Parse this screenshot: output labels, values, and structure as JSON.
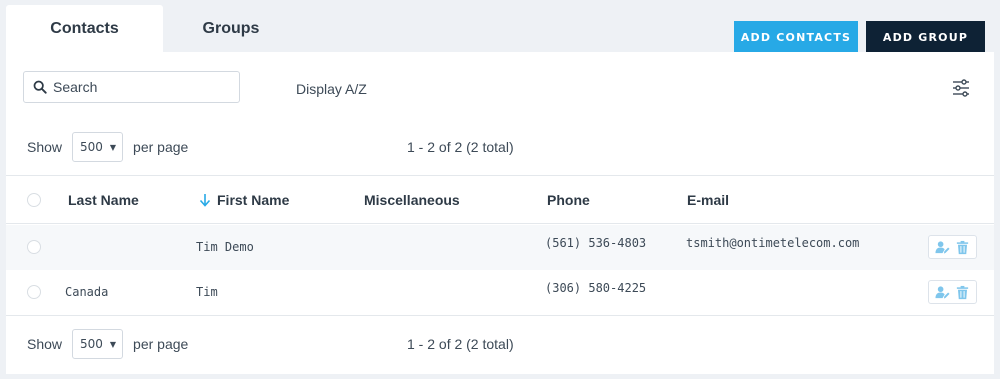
{
  "tabs": [
    {
      "label": "Contacts",
      "active": true
    },
    {
      "label": "Groups",
      "active": false
    }
  ],
  "buttons": {
    "add_contacts": "ADD CONTACTS",
    "add_group": "ADD GROUP"
  },
  "search": {
    "placeholder": "Search",
    "value": ""
  },
  "display_label": "Display A/Z",
  "pager_top": {
    "show": "Show",
    "per_page_value": "500",
    "per_page": "per page",
    "range": "1 - 2 of 2 (2 total)"
  },
  "pager_bottom": {
    "show": "Show",
    "per_page_value": "500",
    "per_page": "per page",
    "range": "1 - 2 of 2 (2 total)"
  },
  "columns": {
    "last_name": "Last Name",
    "first_name": "First Name",
    "misc": "Miscellaneous",
    "phone": "Phone",
    "email": "E-mail"
  },
  "sort": {
    "column": "first_name",
    "direction": "descending",
    "icon": "arrow-down-icon"
  },
  "rows": [
    {
      "last_name": "",
      "first_name": "Tim Demo",
      "misc": "",
      "phone": "(561) 536-4803",
      "email": "tsmith@ontimetelecom.com"
    },
    {
      "last_name": "Canada",
      "first_name": "Tim",
      "misc": "",
      "phone": "(306) 580-4225",
      "email": ""
    }
  ],
  "colors": {
    "accent": "#27a9e6",
    "dark": "#0e2235",
    "icon": "#7fc6ec"
  }
}
